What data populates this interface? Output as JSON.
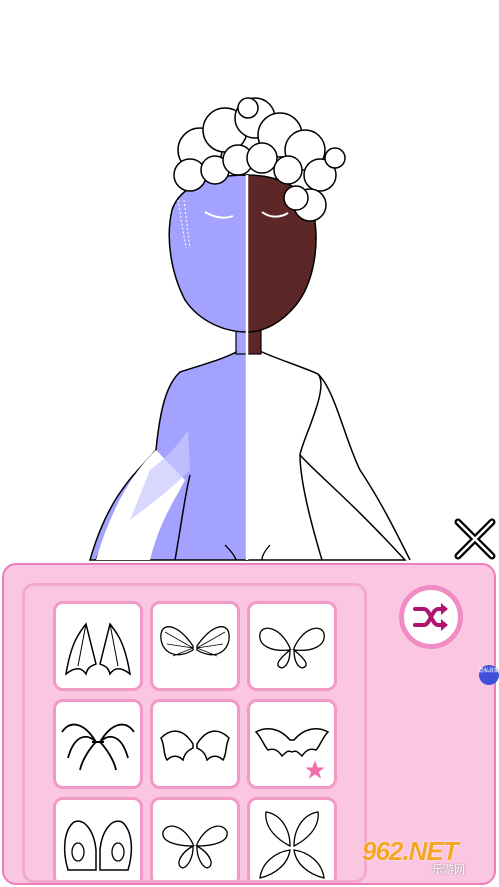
{
  "panel": {
    "shuffle_label": "shuffle-icon",
    "badge_text": "隐私政策",
    "wing_items": [
      {
        "icon": "bat-wings-tall-icon"
      },
      {
        "icon": "butterfly-wings-striped-icon"
      },
      {
        "icon": "fairy-wings-veined-icon"
      },
      {
        "icon": "skeletal-bat-wings-icon"
      },
      {
        "icon": "dragon-wings-small-icon"
      },
      {
        "icon": "bat-wings-wide-icon",
        "favorite": true
      },
      {
        "icon": "moth-wings-icon"
      },
      {
        "icon": "petal-wings-icon"
      },
      {
        "icon": "leaf-wings-icon"
      }
    ]
  },
  "watermark": {
    "logo": "962.NET",
    "sub": "乐游网"
  },
  "colors": {
    "panel_bg": "#fbc6e2",
    "panel_border": "#ec7fb8",
    "shuffle_accent": "#b0146e",
    "skin_left": "#a3a3ff",
    "skin_right": "#5e2727",
    "star": "#f06fa8"
  }
}
